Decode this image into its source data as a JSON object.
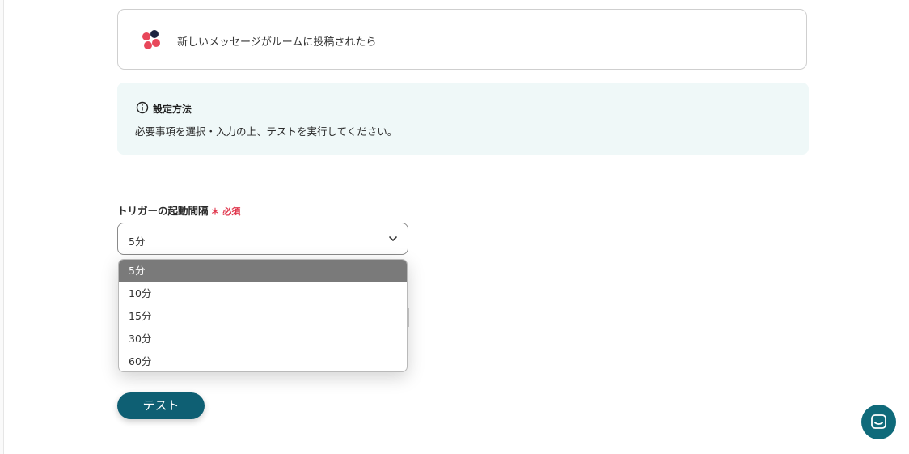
{
  "trigger": {
    "app_icon": "chatwork-logo",
    "text": "新しいメッセージがルームに投稿されたら"
  },
  "info": {
    "icon": "info-circle-icon",
    "title": "設定方法",
    "description": "必要事項を選択・入力の上、テストを実行してください。"
  },
  "interval_field": {
    "label": "トリガーの起動間隔",
    "required": "＊ 必須",
    "value": "5分",
    "options": [
      "5分",
      "10分",
      "15分",
      "30分",
      "60分"
    ],
    "selected_index": 0
  },
  "test_button": {
    "label": "テスト"
  },
  "chat_widget": {
    "icon": "chat-bubble-icon"
  },
  "colors": {
    "accent": "#0e5f73",
    "required": "#e0374d",
    "info_bg": "#eff8f8",
    "selected_option_bg": "#7a7a7a"
  }
}
